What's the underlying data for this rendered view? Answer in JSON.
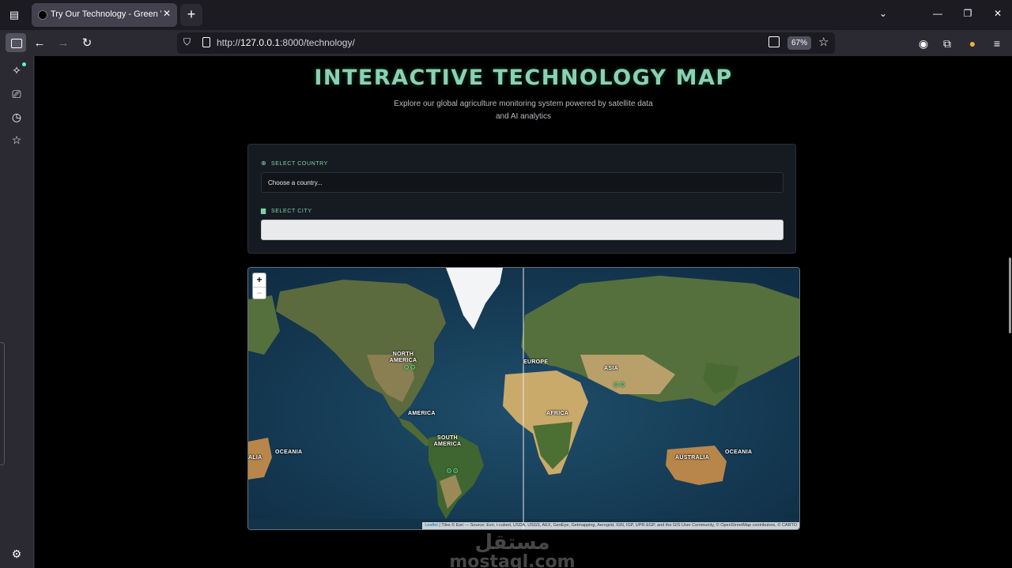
{
  "browser": {
    "tab_title": "Try Our Technology - Green Visi",
    "tab_close": "✕",
    "new_tab": "+",
    "url_prefix": "http://",
    "url_host": "127.0.0.1",
    "url_rest": ":8000/technology/",
    "zoom": "67%"
  },
  "hero": {
    "title": "INTERACTIVE TECHNOLOGY MAP",
    "subtitle": "Explore our global agriculture monitoring system powered by satellite data and AI analytics"
  },
  "selectors": {
    "country_label": "SELECT COUNTRY",
    "country_value": "Choose a country...",
    "city_label": "SELECT CITY",
    "city_value": ""
  },
  "map": {
    "zoom_in": "+",
    "zoom_out": "−",
    "regions": {
      "north_america": "NORTH AMERICA",
      "europe": "EUROPE",
      "asia": "ASIA",
      "america": "AMERICA",
      "africa": "AFRICA",
      "south_america": "SOUTH AMERICA",
      "oceania_left": "OCEANIA",
      "oceania_right": "OCEANIA",
      "australia": "AUSTRALIA",
      "alia_clip": "ALIA"
    },
    "attribution_link": "Leaflet",
    "attribution_text": " | Tiles © Esri — Source: Esri, i-cubed, USDA, USGS, AEX, GeoEye, Getmapping, Aerogrid, IGN, IGP, UPR-EGP, and the GIS User Community, © OpenStreetMap contributors, © CARTO"
  },
  "watermark": {
    "arabic": "مستقل",
    "latin": "mostaql.com"
  }
}
